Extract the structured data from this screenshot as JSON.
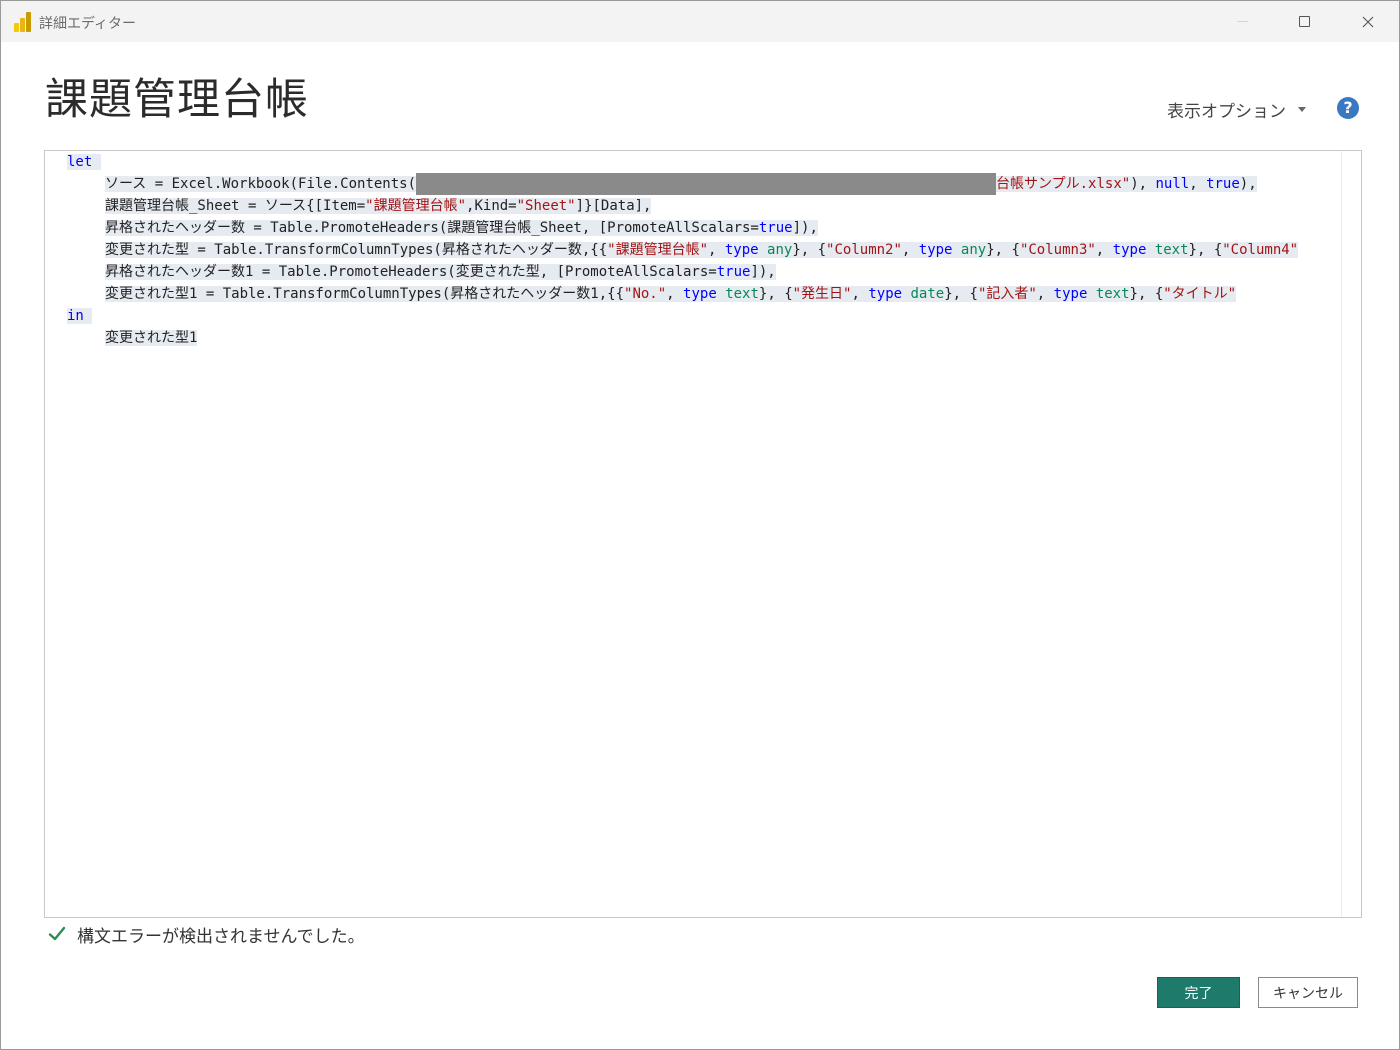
{
  "window": {
    "title": "詳細エディター",
    "app_icon": "power-bi-icon",
    "controls": [
      "minimize-icon",
      "maximize-icon",
      "close-icon"
    ]
  },
  "dialog": {
    "title": "課題管理台帳",
    "view_options_label": "表示オプション",
    "help_icon": "?"
  },
  "editor": {
    "lines": [
      {
        "kw": "let"
      },
      {
        "t1": "ソース = Excel.Workbook(File.Contents(",
        "t2": "台帳サンプル.xlsx\"",
        "t3": "), ",
        "t4": "null",
        "t5": ", ",
        "t6": "true",
        "t7": "),"
      },
      {
        "t1": "課題管理台帳_Sheet = ソース{[Item=",
        "t2": "\"課題管理台帳\"",
        "t3": ",Kind=",
        "t4": "\"Sheet\"",
        "t5": "]}[Data],"
      },
      {
        "t1": "昇格されたヘッダー数 = Table.PromoteHeaders(課題管理台帳_Sheet, [PromoteAllScalars=",
        "t2": "true",
        "t3": "]),"
      },
      {
        "t1": "変更された型 = Table.TransformColumnTypes(昇格されたヘッダー数,{{",
        "t2": "\"課題管理台帳\"",
        "t3": ", ",
        "t4": "type",
        "t5": " ",
        "t6": "any",
        "t7": "}, {",
        "t8": "\"Column2\"",
        "t9": ", ",
        "t10": "type",
        "t11": " ",
        "t12": "any",
        "t13": "}, {",
        "t14": "\"Column3\"",
        "t15": ", ",
        "t16": "type",
        "t17": " ",
        "t18": "text",
        "t19": "}, {",
        "t20": "\"Column4\""
      },
      {
        "t1": "昇格されたヘッダー数1 = Table.PromoteHeaders(変更された型, [PromoteAllScalars=",
        "t2": "true",
        "t3": "]),"
      },
      {
        "t1": "変更された型1 = Table.TransformColumnTypes(昇格されたヘッダー数1,{{",
        "t2": "\"No.\"",
        "t3": ", ",
        "t4": "type",
        "t5": " ",
        "t6": "text",
        "t7": "}, {",
        "t8": "\"発生日\"",
        "t9": ", ",
        "t10": "type",
        "t11": " ",
        "t12": "date",
        "t13": "}, {",
        "t14": "\"記入者\"",
        "t15": ", ",
        "t16": "type",
        "t17": " ",
        "t18": "text",
        "t19": "}, {",
        "t20": "\"タイトル\""
      },
      {
        "kw": "in"
      },
      {
        "t1": "変更された型1"
      }
    ]
  },
  "status": {
    "icon": "checkmark-icon",
    "message": "構文エラーが検出されませんでした。"
  },
  "buttons": {
    "ok_label": "完了",
    "cancel_label": "キャンセル"
  },
  "colors": {
    "ok_button": "#1e7b6b",
    "help_icon": "#3a78c2",
    "keyword": "#0000ff",
    "string": "#a31515",
    "type_name": "#098658",
    "check": "#2e8b57"
  }
}
